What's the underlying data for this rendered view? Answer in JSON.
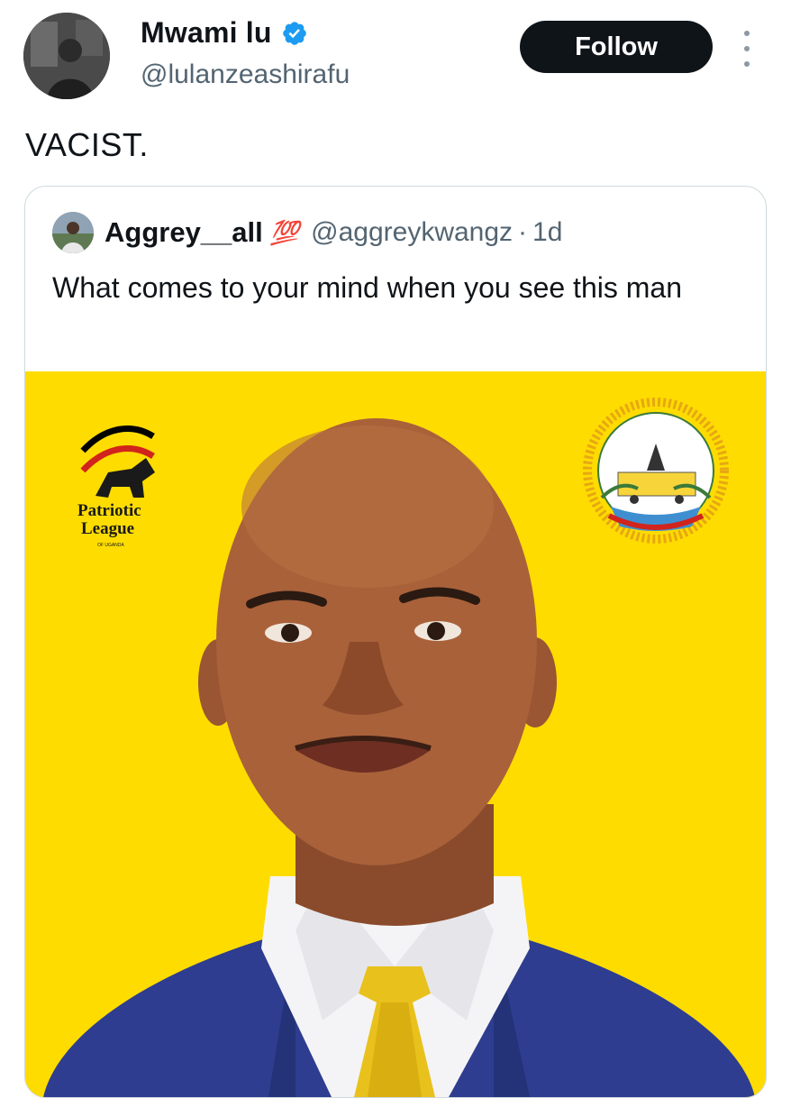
{
  "author": {
    "display_name": "Mwami lu",
    "handle": "@lulanzeashirafu",
    "verified": true,
    "follow_label": "Follow"
  },
  "tweet": {
    "text": "VACIST."
  },
  "quoted": {
    "display_name": "Aggrey__all",
    "emoji": "💯",
    "handle": "@aggreykwangz",
    "separator": "·",
    "time": "1d",
    "text": "What comes to your mind when you see this man",
    "image": {
      "logo_left_line1": "Patriotic",
      "logo_left_line2": "League",
      "logo_left_line3": "OF UGANDA",
      "background_color": "#ffdc00"
    }
  },
  "colors": {
    "accent": "#1d9bf0",
    "follow_bg": "#0f1419",
    "border": "#cfd9de"
  }
}
